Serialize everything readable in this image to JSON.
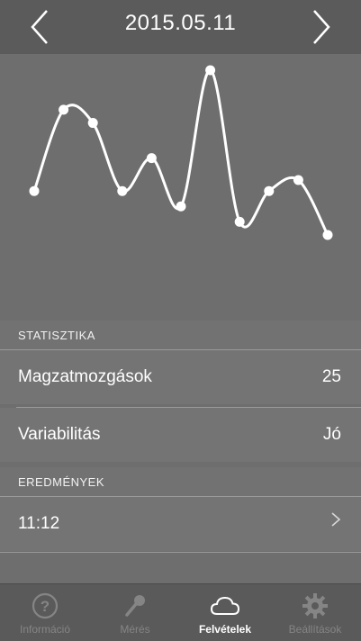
{
  "header": {
    "title": "2015.05.11"
  },
  "chart_data": {
    "type": "line",
    "x": [
      1,
      2,
      3,
      4,
      5,
      6,
      7,
      8,
      9,
      10,
      11
    ],
    "series": [
      {
        "values": [
          0.45,
          0.82,
          0.76,
          0.45,
          0.6,
          0.38,
          1.0,
          0.31,
          0.45,
          0.5,
          0.25
        ]
      }
    ],
    "grid": false
  },
  "sections": {
    "stats": {
      "title": "STATISZTIKA"
    },
    "results": {
      "title": "EREDMÉNYEK"
    }
  },
  "stats": {
    "movements": {
      "label": "Magzatmozgások",
      "value": "25"
    },
    "variability": {
      "label": "Variabilitás",
      "value": "Jó"
    }
  },
  "results": [
    {
      "time": "11:12"
    }
  ],
  "tabs": [
    {
      "label": "Információ",
      "icon": "question-icon",
      "active": false
    },
    {
      "label": "Mérés",
      "icon": "microphone-icon",
      "active": false
    },
    {
      "label": "Felvételek",
      "icon": "cloud-icon",
      "active": true
    },
    {
      "label": "Beállítások",
      "icon": "gear-icon",
      "active": false
    }
  ],
  "colors": {
    "background": "#6e6e6e",
    "header": "#5b5b5b",
    "line": "#ffffff"
  }
}
